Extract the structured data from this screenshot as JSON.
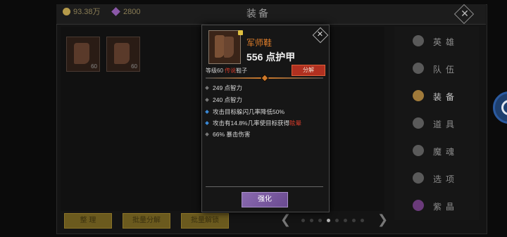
{
  "header": {
    "gold": "93.38万",
    "gems": "2800",
    "title": "装备"
  },
  "inventory": [
    {
      "level": "60"
    },
    {
      "level": "60"
    }
  ],
  "sidebar": [
    {
      "label": "英雄",
      "icon": "hero-icon"
    },
    {
      "label": "队伍",
      "icon": "flag-icon"
    },
    {
      "label": "装备",
      "icon": "helmet-icon",
      "active": true
    },
    {
      "label": "道具",
      "icon": "bag-icon"
    },
    {
      "label": "魔魂",
      "icon": "flame-icon"
    },
    {
      "label": "选项",
      "icon": "gear-icon"
    },
    {
      "label": "紫晶",
      "icon": "crystal-icon"
    }
  ],
  "bottom": {
    "sort": "整 理",
    "batch_salvage": "批量分解",
    "batch_unlock": "批量解锁"
  },
  "popup": {
    "name": "军师鞋",
    "main_stat": "556 点护甲",
    "level_prefix": "等级60 ",
    "level_tag": "传说",
    "level_suffix": "鞋子",
    "salvage": "分解",
    "stats": [
      {
        "text": "249 点智力",
        "style": "normal"
      },
      {
        "text": "240 点智力",
        "style": "normal"
      },
      {
        "text": "攻击目标躲闪几率降低50%",
        "style": "blue"
      },
      {
        "pre": "攻击有14.8%几率使目标获得",
        "hl": "眩晕",
        "style": "blue"
      },
      {
        "text": "66% 暴击伤害",
        "style": "normal"
      }
    ],
    "enhance": "强化"
  },
  "colors": {
    "accent_orange": "#e07e2a",
    "salvage_red": "#b03020",
    "enhance_purple": "#7a5aa0"
  }
}
